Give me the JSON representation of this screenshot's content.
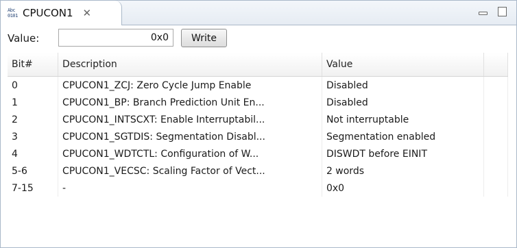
{
  "tab": {
    "title": "CPUCON1",
    "icon_text": "Abc 0101",
    "close_glyph": "✕"
  },
  "value_row": {
    "label": "Value:",
    "input_value": "0x0",
    "write_label": "Write"
  },
  "table": {
    "headers": [
      "Bit#",
      "Description",
      "Value"
    ],
    "rows": [
      {
        "bit": "0",
        "description": "CPUCON1_ZCJ: Zero Cycle Jump Enable",
        "value": "Disabled"
      },
      {
        "bit": "1",
        "description": "CPUCON1_BP: Branch Prediction Unit En...",
        "value": "Disabled"
      },
      {
        "bit": "2",
        "description": "CPUCON1_INTSCXT: Enable Interruptabil...",
        "value": "Not interruptable"
      },
      {
        "bit": "3",
        "description": "CPUCON1_SGTDIS: Segmentation Disabl...",
        "value": "Segmentation enabled"
      },
      {
        "bit": "4",
        "description": "CPUCON1_WDTCTL: Configuration of W...",
        "value": "DISWDT before EINIT"
      },
      {
        "bit": "5-6",
        "description": "CPUCON1_VECSC: Scaling Factor of Vect...",
        "value": "2 words"
      },
      {
        "bit": "7-15",
        "description": "-",
        "value": "0x0"
      }
    ]
  }
}
